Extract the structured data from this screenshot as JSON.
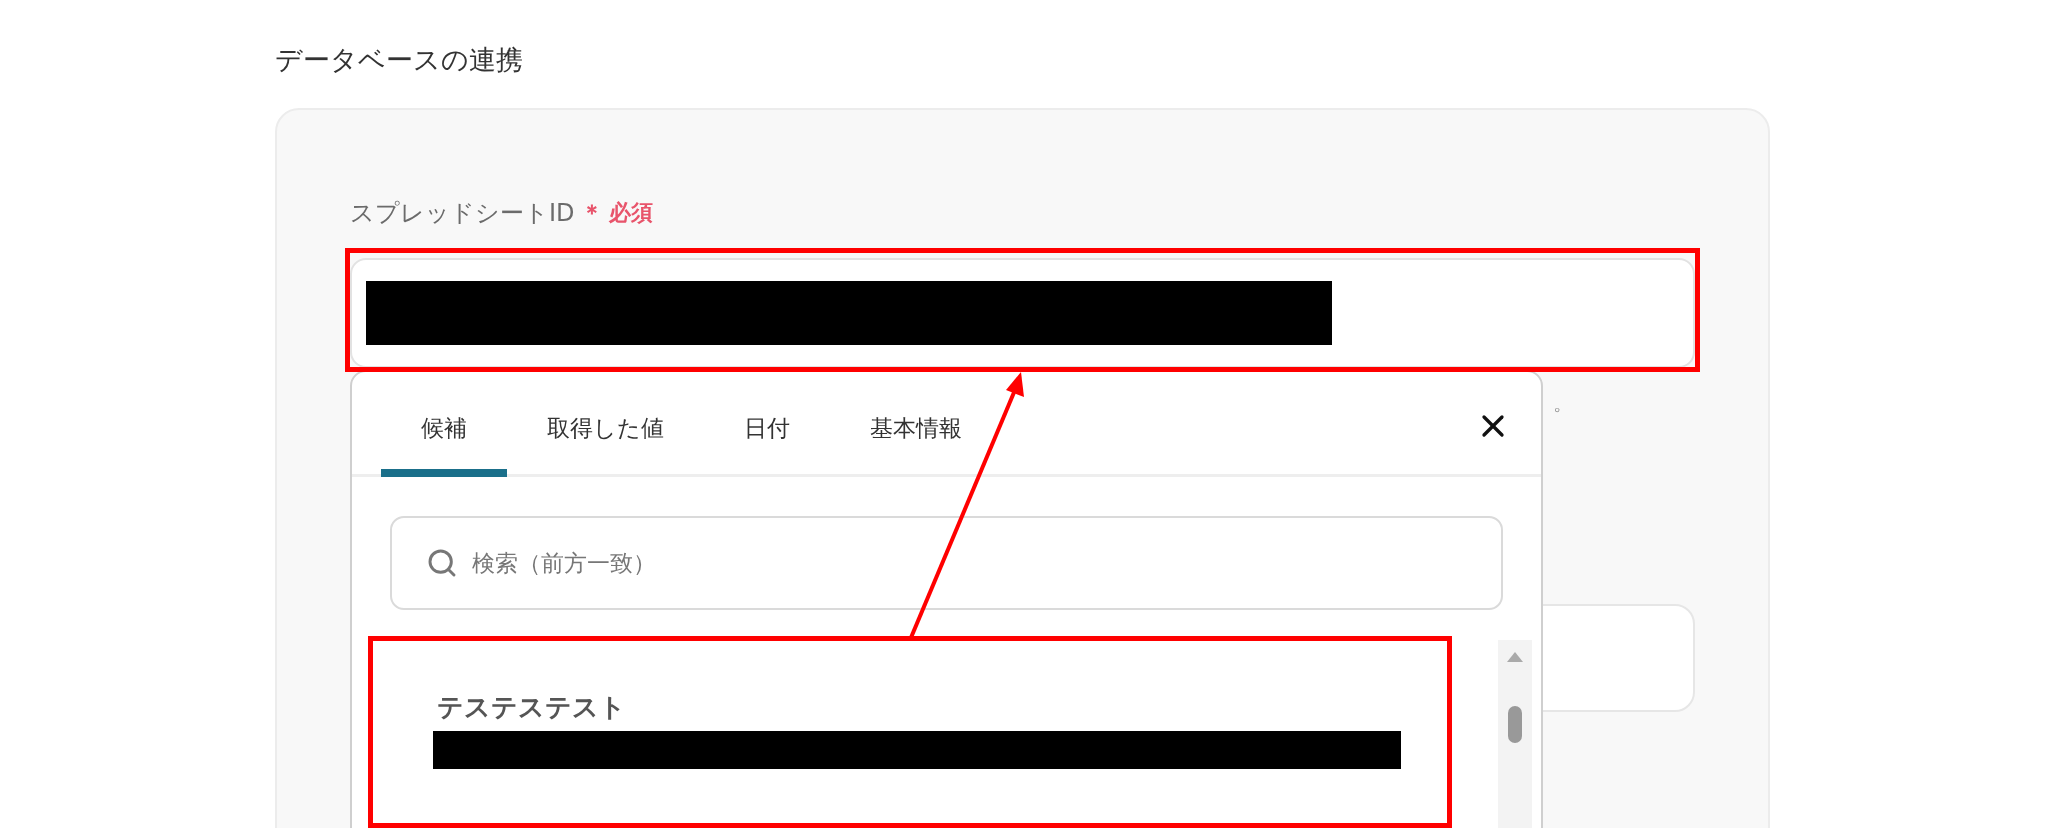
{
  "section_title": "データベースの連携",
  "field": {
    "label": "スプレッドシートID",
    "required_mark": "＊",
    "required_text": "必須"
  },
  "helper_text_tail": "。",
  "picker": {
    "tabs": [
      {
        "label": "候補",
        "selected": true
      },
      {
        "label": "取得した値",
        "selected": false
      },
      {
        "label": "日付",
        "selected": false
      },
      {
        "label": "基本情報",
        "selected": false
      }
    ],
    "search": {
      "placeholder": "検索（前方一致）"
    },
    "items": [
      {
        "title": "テステステスト"
      }
    ]
  }
}
